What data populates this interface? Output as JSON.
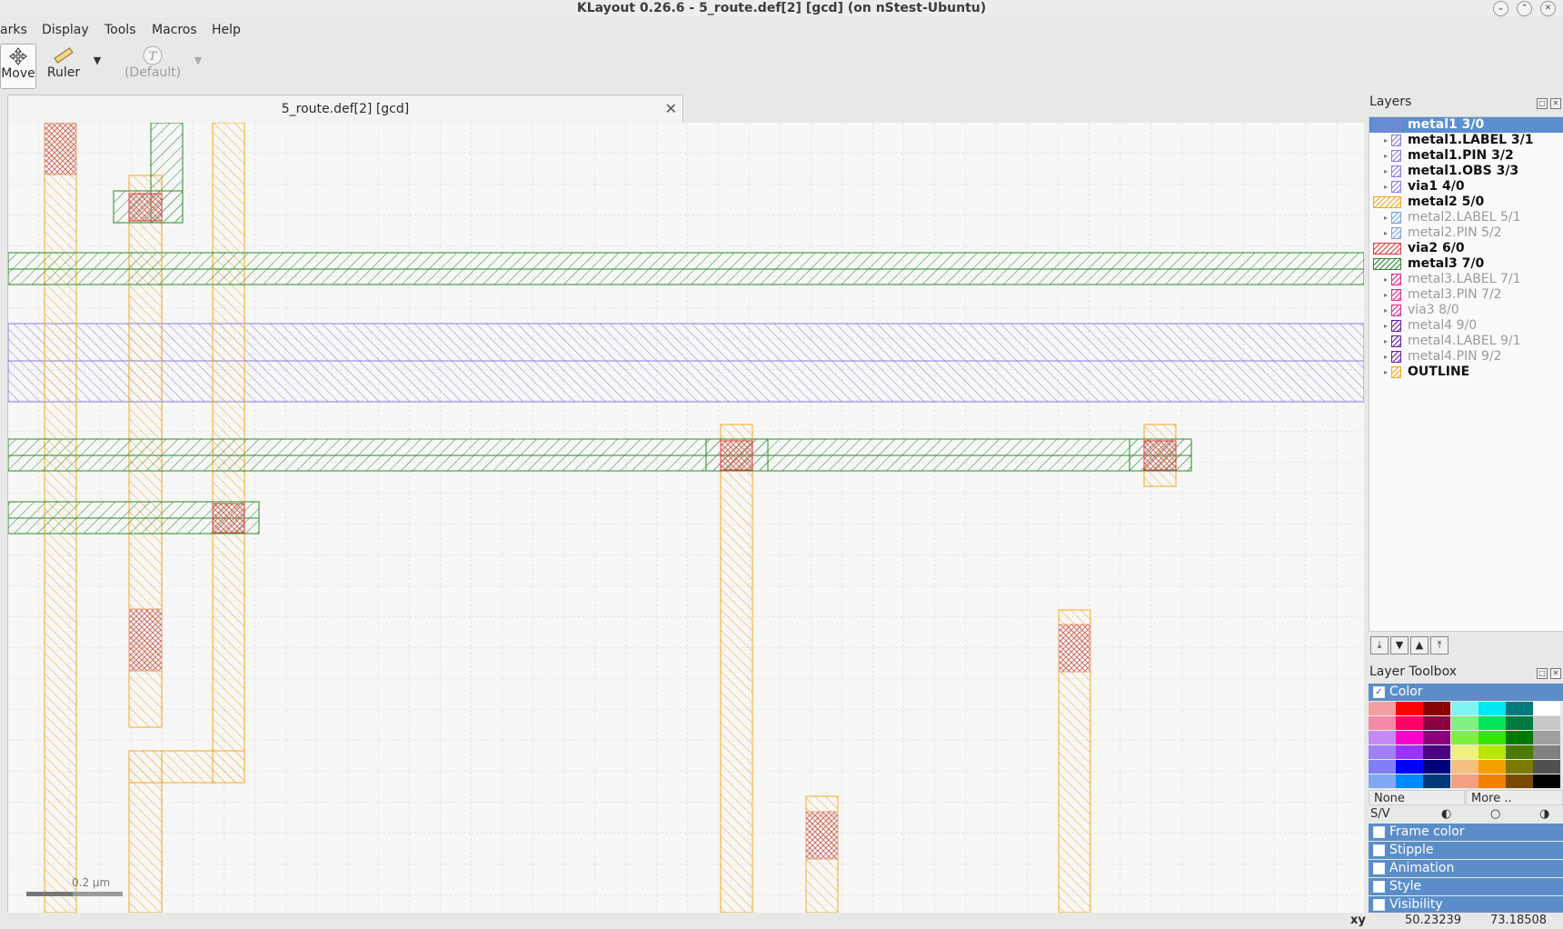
{
  "window": {
    "title": "KLayout 0.26.6 - 5_route.def[2] [gcd] (on nStest-Ubuntu)"
  },
  "menu": [
    "arks",
    "Display",
    "Tools",
    "Macros",
    "Help"
  ],
  "toolbar": {
    "move_label": "Move",
    "ruler_label": "Ruler",
    "text_label": "(Default)"
  },
  "tab": {
    "label": "5_route.def[2] [gcd]"
  },
  "canvas": {
    "scale_label": "0.2 µm"
  },
  "layers_panel": {
    "title": "Layers",
    "items": [
      {
        "label": "metal1 3/0",
        "color": "#8a7ee0",
        "style": "sel"
      },
      {
        "label": "metal1.LABEL 3/1",
        "color": "#8a7ee0",
        "style": "bold"
      },
      {
        "label": "metal1.PIN 3/2",
        "color": "#8a7ee0",
        "style": "bold"
      },
      {
        "label": "metal1.OBS 3/3",
        "color": "#8a7ee0",
        "style": "bold"
      },
      {
        "label": "via1 4/0",
        "color": "#8a7ee0",
        "style": "bold"
      },
      {
        "label": "metal2 5/0",
        "color": "#f4a81e",
        "style": "bold"
      },
      {
        "label": "metal2.LABEL 5/1",
        "color": "#7aa0e0",
        "style": "dim"
      },
      {
        "label": "metal2.PIN 5/2",
        "color": "#7aa0e0",
        "style": "dim"
      },
      {
        "label": "via2 6/0",
        "color": "#e23a3a",
        "style": "bold"
      },
      {
        "label": "metal3 7/0",
        "color": "#2e8b2e",
        "style": "bold"
      },
      {
        "label": "metal3.LABEL 7/1",
        "color": "#e0288c",
        "style": "dim"
      },
      {
        "label": "metal3.PIN 7/2",
        "color": "#e0288c",
        "style": "dim"
      },
      {
        "label": "via3 8/0",
        "color": "#e0288c",
        "style": "dim"
      },
      {
        "label": "metal4 9/0",
        "color": "#6a1ea0",
        "style": "dim"
      },
      {
        "label": "metal4.LABEL 9/1",
        "color": "#6a1ea0",
        "style": "dim"
      },
      {
        "label": "metal4.PIN 9/2",
        "color": "#6a1ea0",
        "style": "dim"
      },
      {
        "label": "OUTLINE",
        "color": "#f4a81e",
        "style": "bold"
      }
    ]
  },
  "layer_toolbox": {
    "title": "Layer Toolbox",
    "color_label": "Color",
    "palette": [
      [
        "#f4a0a0",
        "#ff0000",
        "#8a0000",
        "#80f4f4",
        "#00e8f4",
        "#007a7a",
        "#ffffff"
      ],
      [
        "#f48aa8",
        "#ff0066",
        "#8a0040",
        "#80f080",
        "#00e85a",
        "#007a40",
        "#c8c8c8"
      ],
      [
        "#c48af4",
        "#ff00cc",
        "#8a007a",
        "#80f040",
        "#33e800",
        "#007a00",
        "#a0a0a0"
      ],
      [
        "#a080f4",
        "#9933ff",
        "#4a0082",
        "#f0f080",
        "#b8e800",
        "#4a7a00",
        "#808080"
      ],
      [
        "#8080f4",
        "#0000ff",
        "#00007a",
        "#f4c080",
        "#f4a000",
        "#7a7a00",
        "#505050"
      ],
      [
        "#80a8f4",
        "#0088ff",
        "#003a7a",
        "#f4a080",
        "#f48000",
        "#7a4a00",
        "#000000"
      ]
    ],
    "none_label": "None",
    "more_label": "More ..",
    "sv_label": "S/V",
    "sections": [
      "Frame color",
      "Stipple",
      "Animation",
      "Style",
      "Visibility"
    ]
  },
  "status": {
    "xy_label": "xy",
    "x_value": "50.23239",
    "y_value": "73.18508"
  },
  "colors": {
    "metal1": "#7b6ce0",
    "metal2": "#f4a81e",
    "metal3": "#2a8a2a",
    "via2": "#e23a3a",
    "accent": "#5b8ec9"
  }
}
